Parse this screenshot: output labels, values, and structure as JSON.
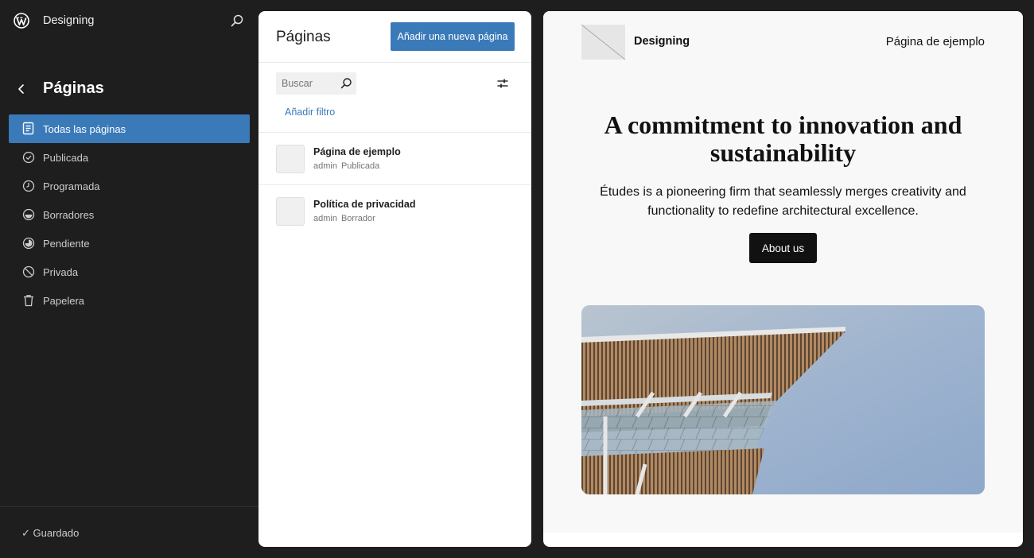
{
  "sidebar": {
    "site_name": "Designing",
    "section_title": "Páginas",
    "nav": [
      {
        "label": "Todas las páginas",
        "icon": "pages-icon",
        "active": true
      },
      {
        "label": "Publicada",
        "icon": "check-circle-icon"
      },
      {
        "label": "Programada",
        "icon": "clock-icon"
      },
      {
        "label": "Borradores",
        "icon": "draft-icon"
      },
      {
        "label": "Pendiente",
        "icon": "pending-icon"
      },
      {
        "label": "Privada",
        "icon": "private-icon"
      },
      {
        "label": "Papelera",
        "icon": "trash-icon"
      }
    ],
    "status": "Guardado"
  },
  "pages_panel": {
    "title": "Páginas",
    "add_button": "Añadir una nueva página",
    "search_placeholder": "Buscar",
    "add_filter": "Añadir filtro",
    "rows": [
      {
        "title": "Página de ejemplo",
        "author": "admin",
        "status": "Publicada"
      },
      {
        "title": "Política de privacidad",
        "author": "admin",
        "status": "Borrador"
      }
    ]
  },
  "preview": {
    "site_name": "Designing",
    "nav_link": "Página de ejemplo",
    "hero_title": "A commitment to innovation and sustainability",
    "hero_description": "Études is a pioneering firm that seamlessly merges creativity and functionality to redefine architectural excellence.",
    "cta": "About us"
  },
  "colors": {
    "accent": "#3a7ab9",
    "sidebar_bg": "#1e1e1e",
    "preview_bg": "#f8f8f8"
  }
}
